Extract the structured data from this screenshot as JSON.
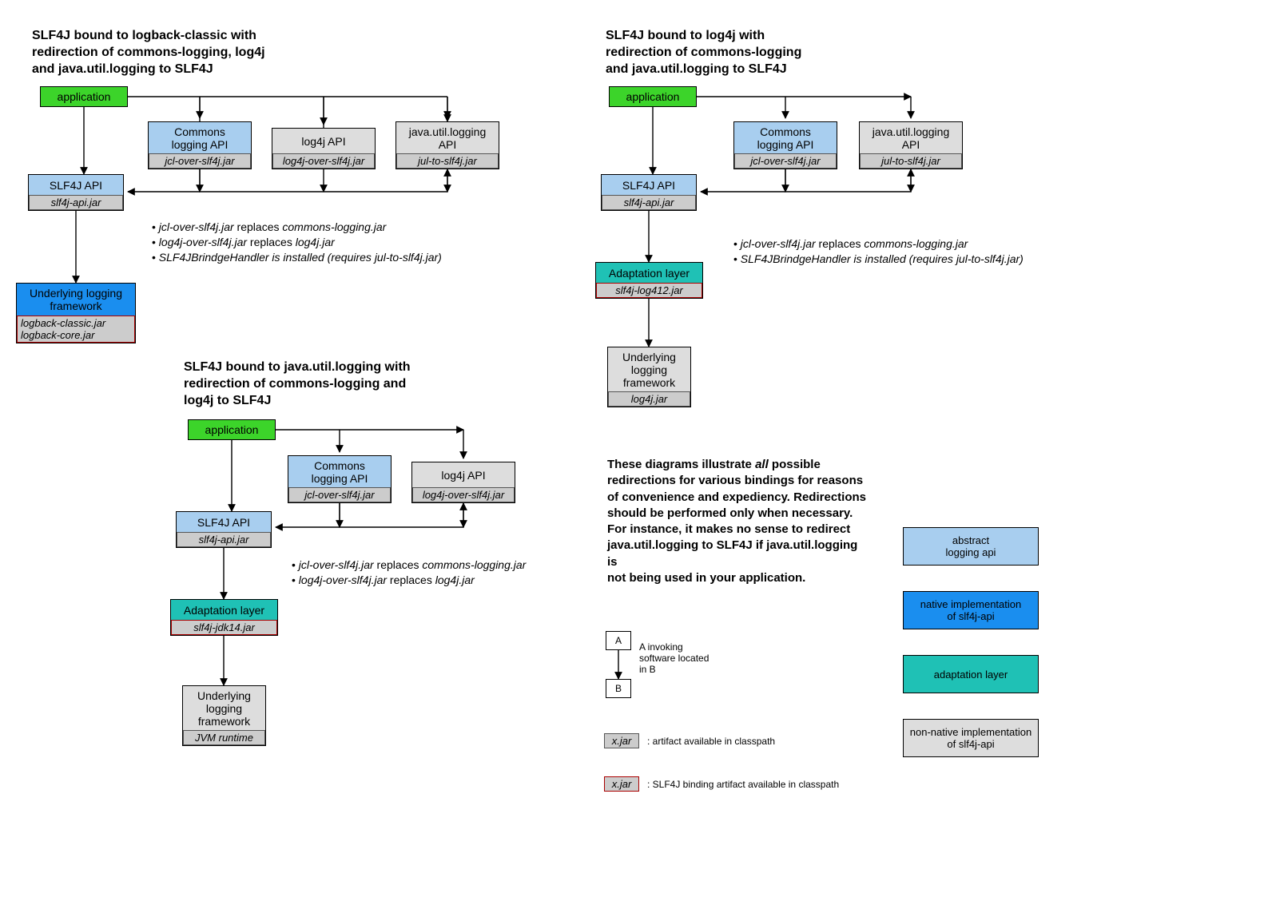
{
  "d1": {
    "title": "SLF4J bound to logback-classic with\nredirection of commons-logging, log4j\nand java.util.logging to SLF4J",
    "app": "application",
    "commons": "Commons\nlogging API",
    "commons_jar": "jcl-over-slf4j.jar",
    "log4j": "log4j API",
    "log4j_jar": "log4j-over-slf4j.jar",
    "jul": "java.util.logging\nAPI",
    "jul_jar": "jul-to-slf4j.jar",
    "slf4j": "SLF4J API",
    "slf4j_jar": "slf4j-api.jar",
    "underlying": "Underlying logging\nframework",
    "underlying_jar": "logback-classic.jar\nlogback-core.jar",
    "n1a": "jcl-over-slf4j.jar",
    "n1b": " replaces ",
    "n1c": "commons-logging.jar",
    "n2a": "log4j-over-slf4j.jar",
    "n2b": " replaces ",
    "n2c": "log4j.jar",
    "n3a": "SLF4JBrindgeHandler is installed (requires jul-to-slf4j.jar)"
  },
  "d2": {
    "title": "SLF4J bound to java.util.logging with\nredirection of commons-logging and\nlog4j to SLF4J",
    "app": "application",
    "commons": "Commons\nlogging API",
    "commons_jar": "jcl-over-slf4j.jar",
    "log4j": "log4j API",
    "log4j_jar": "log4j-over-slf4j.jar",
    "slf4j": "SLF4J API",
    "slf4j_jar": "slf4j-api.jar",
    "adapt": "Adaptation layer",
    "adapt_jar": "slf4j-jdk14.jar",
    "underlying": "Underlying\nlogging\nframework",
    "underlying_jar": "JVM runtime",
    "n1a": "jcl-over-slf4j.jar",
    "n1b": " replaces ",
    "n1c": "commons-logging.jar",
    "n2a": "log4j-over-slf4j.jar",
    "n2b": " replaces ",
    "n2c": "log4j.jar"
  },
  "d3": {
    "title": "SLF4J bound to log4j with\nredirection of commons-logging\nand java.util.logging to SLF4J",
    "app": "application",
    "commons": "Commons\nlogging API",
    "commons_jar": "jcl-over-slf4j.jar",
    "jul": "java.util.logging\nAPI",
    "jul_jar": "jul-to-slf4j.jar",
    "slf4j": "SLF4J API",
    "slf4j_jar": "slf4j-api.jar",
    "adapt": "Adaptation layer",
    "adapt_jar": "slf4j-log412.jar",
    "underlying": "Underlying\nlogging\nframework",
    "underlying_jar": "log4j.jar",
    "n1a": "jcl-over-slf4j.jar",
    "n1b": " replaces ",
    "n1c": "commons-logging.jar",
    "n2a": "SLF4JBrindgeHandler is installed (requires jul-to-slf4j.jar)"
  },
  "summary": {
    "p1": "These diagrams illustrate ",
    "p1i": "all",
    "p2": " possible redirections for various bindings for reasons of convenience and expediency. Redirections should be performed only when necessary. For instance, it makes no sense to redirect java.util.logging to SLF4J if java.util.logging is",
    "p3": "not being used in your application."
  },
  "legend": {
    "a": "A",
    "b": "B",
    "ab": "A invoking\nsoftware located\nin B",
    "xjar": "x.jar",
    "xjar_txt": ": artifact available in classpath",
    "xjar2": "x.jar",
    "xjar2_txt": ": SLF4J binding artifact available in classpath",
    "abs": "abstract\nlogging api",
    "nat": "native implementation\nof slf4j-api",
    "ada": "adaptation layer",
    "non": "non-native implementation\nof slf4j-api"
  }
}
